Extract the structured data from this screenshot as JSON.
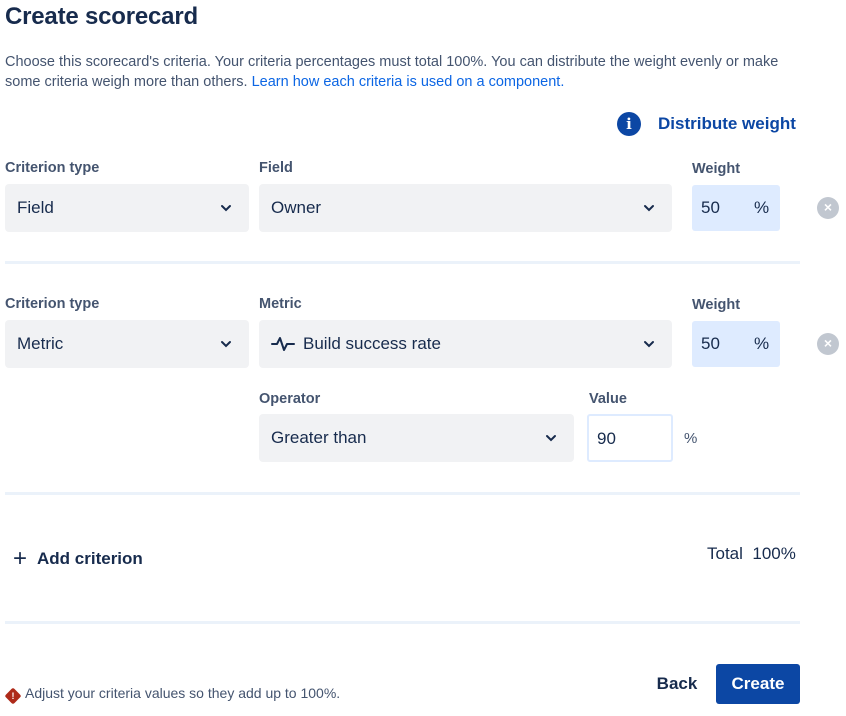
{
  "page": {
    "title": "Create scorecard",
    "description": "Choose this scorecard's criteria. Your criteria percentages must total 100%. You can distribute the weight evenly or make some criteria weigh more than others.",
    "learn_link": "Learn how each criteria is used on a component.",
    "distribute_label": "Distribute weight",
    "info_icon_glyph": "i"
  },
  "criteria": [
    {
      "type_label": "Criterion type",
      "type_value": "Field",
      "field_label": "Field",
      "field_value": "Owner",
      "weight_label": "Weight",
      "weight_value": "50",
      "weight_unit": "%"
    },
    {
      "type_label": "Criterion type",
      "type_value": "Metric",
      "field_label": "Metric",
      "field_value": "Build success rate",
      "field_icon": "metric-pulse-icon",
      "weight_label": "Weight",
      "weight_value": "50",
      "weight_unit": "%",
      "operator_label": "Operator",
      "operator_value": "Greater than",
      "value_label": "Value",
      "value_value": "90",
      "value_unit": "%"
    }
  ],
  "footer": {
    "add_label": "Add criterion",
    "total_label": "Total",
    "total_value": "100%",
    "warning": "Adjust your criteria values so they add up to 100%.",
    "back_label": "Back",
    "create_label": "Create"
  },
  "colors": {
    "accent": "#0C47A4",
    "link": "#0C66E4",
    "weight_bg": "#DEEBFF",
    "select_bg": "#F1F2F4",
    "error": "#AE2A19"
  }
}
